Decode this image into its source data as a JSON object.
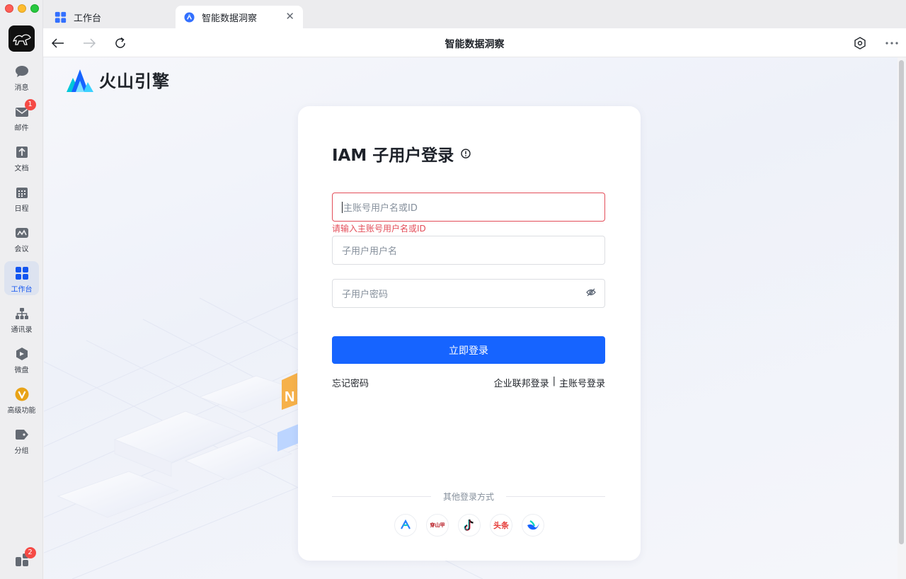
{
  "window": {
    "tabs": [
      {
        "label": "工作台"
      },
      {
        "label": "智能数据洞察"
      }
    ]
  },
  "toolbar": {
    "title": "智能数据洞察"
  },
  "sidebar": {
    "badges": {
      "mail": "1",
      "bottom": "2"
    },
    "items": [
      {
        "label": "消息"
      },
      {
        "label": "邮件"
      },
      {
        "label": "文档"
      },
      {
        "label": "日程"
      },
      {
        "label": "会议"
      },
      {
        "label": "工作台"
      },
      {
        "label": "通讯录"
      },
      {
        "label": "微盘"
      },
      {
        "label": "高级功能"
      },
      {
        "label": "分组"
      }
    ]
  },
  "page": {
    "brand": "火山引擎",
    "login": {
      "title": "IAM 子用户登录",
      "account_placeholder": "主账号用户名或ID",
      "account_error": "请输入主账号用户名或ID",
      "username_placeholder": "子用户用户名",
      "password_placeholder": "子用户密码",
      "submit_label": "立即登录",
      "forgot_label": "忘记密码",
      "federated_label": "企业联邦登录",
      "separator": "|",
      "main_account_label": "主账号登录",
      "other_methods_label": "其他登录方式",
      "providers": [
        {
          "icon": "provider-1-icon"
        },
        {
          "icon": "provider-2-icon",
          "text": "穿山甲"
        },
        {
          "icon": "douyin-icon"
        },
        {
          "icon": "toutiao-icon",
          "text": "头条"
        },
        {
          "icon": "feishu-icon"
        }
      ]
    }
  },
  "colors": {
    "primary": "#1664ff",
    "error": "#e34d59",
    "active_nav": "#1456f0"
  }
}
